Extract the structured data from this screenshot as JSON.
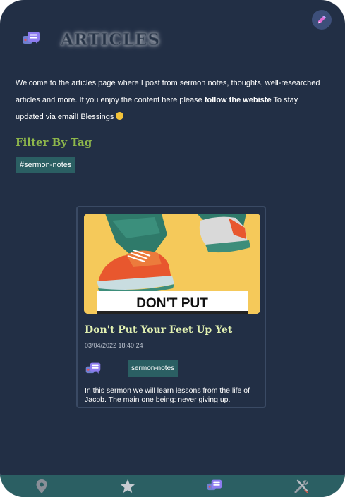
{
  "header": {
    "title": "ARTICLES",
    "icon": "chat-bubbles-icon"
  },
  "theme_toggle": {
    "icon": "pen-icon"
  },
  "intro": {
    "text_before": "Welcome to the articles page where I post from sermon notes, thoughts, well-researched articles and more. If you enjoy the content here please ",
    "link_text": "follow the webiste",
    "text_after": " To stay updated via email! Blessings"
  },
  "filter": {
    "heading": "Filter By Tag",
    "tags": [
      "#sermon-notes"
    ]
  },
  "articles": [
    {
      "image_text": "DON'T PUT",
      "title": "Don't Put Your Feet Up Yet",
      "date": "03/04/2022 18:40:24",
      "tag": "sermon-notes",
      "description": "In this sermon we will learn lessons from the life of Jacob. The main one being: never giving up."
    }
  ],
  "bottom_nav": [
    {
      "name": "map-pin-icon"
    },
    {
      "name": "star-icon"
    },
    {
      "name": "chat-bubbles-icon"
    },
    {
      "name": "tools-icon"
    }
  ],
  "colors": {
    "background": "#222f45",
    "accent_green": "#8fb84b",
    "tag_bg": "#2b5f63",
    "title_light": "#e3f2b2"
  }
}
